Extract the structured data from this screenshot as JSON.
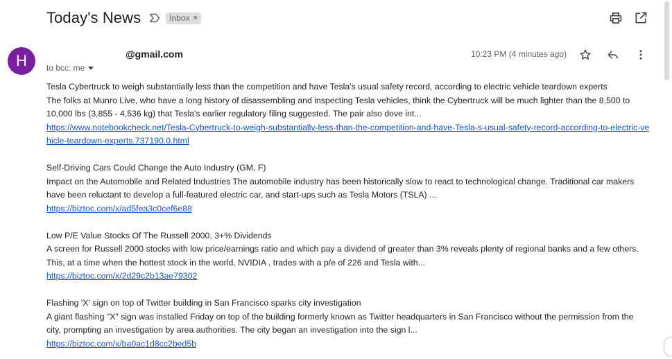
{
  "header": {
    "subject": "Today's News",
    "label": "Inbox",
    "label_remove": "×",
    "icons": {
      "important": "label-important-outline-icon",
      "print": "print-icon",
      "new_window": "open-in-new-window-icon"
    }
  },
  "message": {
    "avatar_initial": "H",
    "avatar_color": "#7b1fa2",
    "sender": "@gmail.com",
    "recipients": "to bcc: me",
    "timestamp": "10:23 PM (4 minutes ago)",
    "icons": {
      "star": "star-outline-icon",
      "reply": "reply-icon",
      "more": "more-vert-icon"
    }
  },
  "articles": [
    {
      "title": "Tesla Cybertruck to weigh substantially less than the competition and have Tesla's usual safety record, according to electric vehicle teardown experts",
      "desc": "The folks at Munro Live, who have a long history of disassembling and inspecting Tesla vehicles, think the Cybertruck will be much lighter than the 8,500 to 10,000 lbs (3,855 - 4,536 kg) that Tesla's earlier regulatory filing suggested. The pair also dove int...",
      "link": "https://www.notebookcheck.net/Tesla-Cybertruck-to-weigh-substantially-less-than-the-competition-and-have-Tesla-s-usual-safety-record-according-to-electric-vehicle-teardown-experts.737190.0.html"
    },
    {
      "title": "Self-Driving Cars Could Change the Auto Industry (GM, F)",
      "desc": "Impact on the Automobile and Related Industries The automobile industry has been historically slow to react to technological change. Traditional car makers have been reluctant to develop a full-featured electric car, and start-ups such as Tesla Motors (TSLA) ...",
      "link": "https://biztoc.com/x/ad5fea3c0cef6e88"
    },
    {
      "title": "Low P/E Value Stocks Of The Russell 2000, 3+% Dividends",
      "desc": "A screen for Russell 2000 stocks with low price/earnings ratio and which pay a dividend of greater than 3% reveals plenty of regional banks and a few others. This, at a time when the hottest stock in the world, NVIDIA , trades with a p/e of 226 and Tesla with...",
      "link": "https://biztoc.com/x/2d29c2b13ae79302"
    },
    {
      "title": "Flashing 'X' sign on top of Twitter building in San Francisco sparks city investigation",
      "desc": "A giant flashing \"X\" sign was installed Friday on top of the building formerly known as Twitter headquarters in San Francisco without the permission from the city, prompting an investigation by area authorities. The city began an investigation into the sign l...",
      "link": "https://biztoc.com/x/ba0ac1d8cc2bed5b"
    }
  ]
}
